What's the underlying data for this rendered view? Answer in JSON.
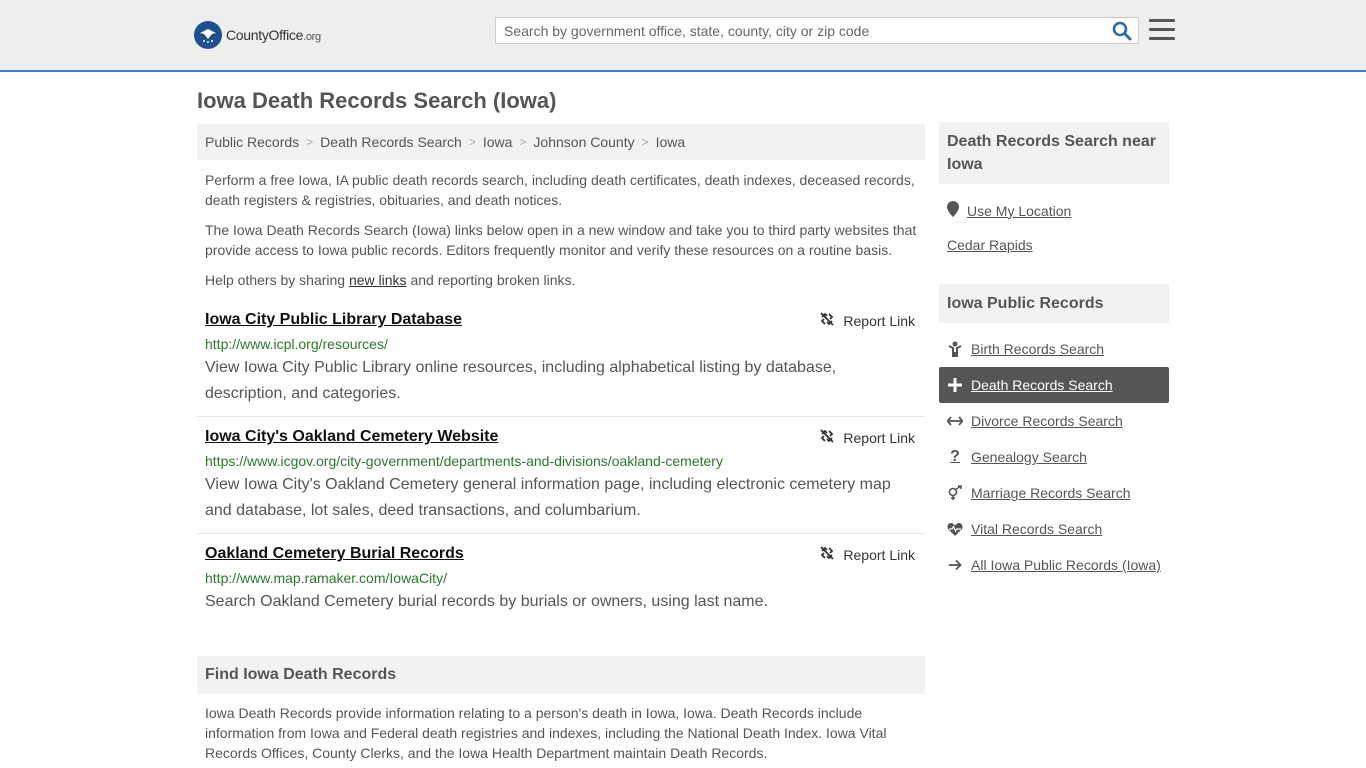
{
  "header": {
    "logo_name": "CountyOffice",
    "logo_tld": ".org",
    "search_placeholder": "Search by government office, state, county, city or zip code"
  },
  "page_title": "Iowa Death Records Search (Iowa)",
  "breadcrumb": [
    "Public Records",
    "Death Records Search",
    "Iowa",
    "Johnson County",
    "Iowa"
  ],
  "intro": {
    "p1": "Perform a free Iowa, IA public death records search, including death certificates, death indexes, deceased records, death registers & registries, obituaries, and death notices.",
    "p2": "The Iowa Death Records Search (Iowa) links below open in a new window and take you to third party websites that provide access to Iowa public records. Editors frequently monitor and verify these resources on a routine basis.",
    "p3_before": "Help others by sharing ",
    "p3_link": "new links",
    "p3_after": " and reporting broken links."
  },
  "listings": [
    {
      "title": "Iowa City Public Library Database",
      "url": "http://www.icpl.org/resources/",
      "desc": "View Iowa City Public Library online resources, including alphabetical listing by database, description, and categories.",
      "report": "Report Link"
    },
    {
      "title": "Iowa City's Oakland Cemetery Website",
      "url": "https://www.icgov.org/city-government/departments-and-divisions/oakland-cemetery",
      "desc": "View Iowa City's Oakland Cemetery general information page, including electronic cemetery map and database, lot sales, deed transactions, and columbarium.",
      "report": "Report Link"
    },
    {
      "title": "Oakland Cemetery Burial Records",
      "url": "http://www.map.ramaker.com/IowaCity/",
      "desc": "Search Oakland Cemetery burial records by burials or owners, using last name.",
      "report": "Report Link"
    }
  ],
  "find_section": {
    "heading": "Find Iowa Death Records",
    "text": "Iowa Death Records provide information relating to a person's death in Iowa, Iowa. Death Records include information from Iowa and Federal death registries and indexes, including the National Death Index. Iowa Vital Records Offices, County Clerks, and the Iowa Health Department maintain Death Records."
  },
  "sidebar": {
    "near_heading": "Death Records Search near Iowa",
    "use_location": "Use My Location",
    "nearby": [
      "Cedar Rapids"
    ],
    "public_heading": "Iowa Public Records",
    "items": [
      {
        "label": "Birth Records Search",
        "icon": "child-icon"
      },
      {
        "label": "Death Records Search",
        "icon": "cross-icon",
        "active": true
      },
      {
        "label": "Divorce Records Search",
        "icon": "arrows-icon"
      },
      {
        "label": "Genealogy Search",
        "icon": "question-icon"
      },
      {
        "label": "Marriage Records Search",
        "icon": "venus-mars-icon"
      },
      {
        "label": "Vital Records Search",
        "icon": "heartbeat-icon"
      },
      {
        "label": "All Iowa Public Records (Iowa)",
        "icon": "arrow-right-icon"
      }
    ]
  },
  "colors": {
    "accent": "#3f7cc0",
    "link_green": "#2a7a2a",
    "active_nav": "#555555"
  }
}
